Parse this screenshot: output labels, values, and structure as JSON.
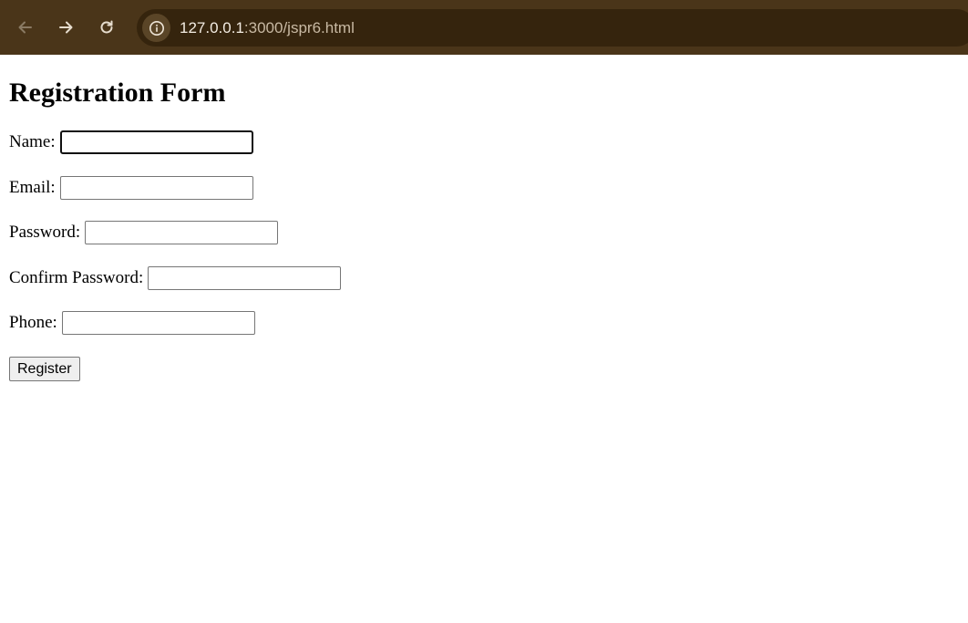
{
  "browser": {
    "url_host": "127.0.0.1",
    "url_path": ":3000/jspr6.html",
    "back_icon": "arrow-left-icon",
    "forward_icon": "arrow-right-icon",
    "reload_icon": "reload-icon",
    "info_icon": "info-icon"
  },
  "form": {
    "title": "Registration Form",
    "fields": [
      {
        "label": "Name:",
        "value": "",
        "focused": true
      },
      {
        "label": "Email:",
        "value": ""
      },
      {
        "label": "Password:",
        "value": ""
      },
      {
        "label": "Confirm Password:",
        "value": ""
      },
      {
        "label": "Phone:",
        "value": ""
      }
    ],
    "submit_label": "Register"
  }
}
